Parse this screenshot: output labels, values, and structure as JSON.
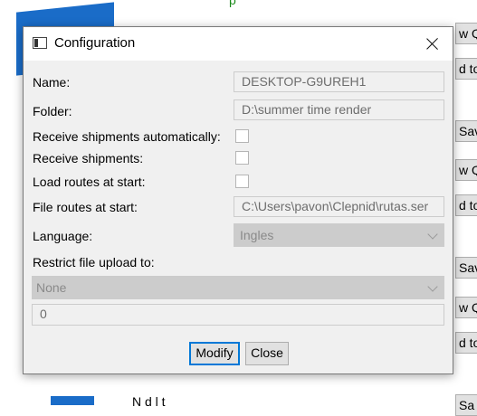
{
  "background": {
    "green_text": "p",
    "side_buttons": [
      "w Q",
      "d to",
      "Sav",
      "w Q",
      "d to",
      "Sav",
      "w Q",
      "d to",
      "Sa"
    ],
    "bottom_text": "N  d  l  t"
  },
  "dialog": {
    "title": "Configuration",
    "fields": {
      "name_label": "Name:",
      "name_value": "DESKTOP-G9UREH1",
      "folder_label": "Folder:",
      "folder_value": "D:\\summer time render",
      "receive_auto_label": "Receive shipments automatically:",
      "receive_label": "Receive shipments:",
      "load_routes_label": "Load routes at start:",
      "file_routes_label": "File routes at start:",
      "file_routes_value": "C:\\Users\\pavon\\Clepnid\\rutas.ser",
      "language_label": "Language:",
      "language_value": "Ingles",
      "restrict_label": "Restrict file upload to:",
      "restrict_value": "None",
      "size_value": "0"
    },
    "buttons": {
      "modify": "Modify",
      "close": "Close"
    }
  }
}
